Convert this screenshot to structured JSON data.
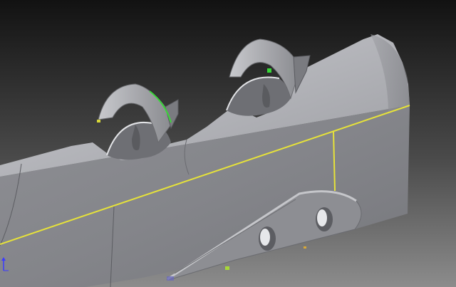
{
  "app": {
    "type": "3D CAD modeling viewport"
  },
  "scene": {
    "model": "fuselage-body",
    "features": [
      "cockpit-opening-front",
      "cockpit-opening-rear",
      "windscreen-front",
      "windscreen-rear",
      "wing-root-fairing",
      "lightening-hole-left",
      "lightening-hole-right",
      "longitudinal-sketch-line",
      "vertical-sketch-line"
    ],
    "sketch_highlight_color": "#e6e23a",
    "selected_edge_color": "#38d838",
    "background_top_color": "#121212",
    "background_bottom_color": "#8c8c8c",
    "body_color": "#9a9ba0"
  },
  "triad": {
    "icon": "view-triad-icon",
    "axis_color": "#3b3bff"
  }
}
